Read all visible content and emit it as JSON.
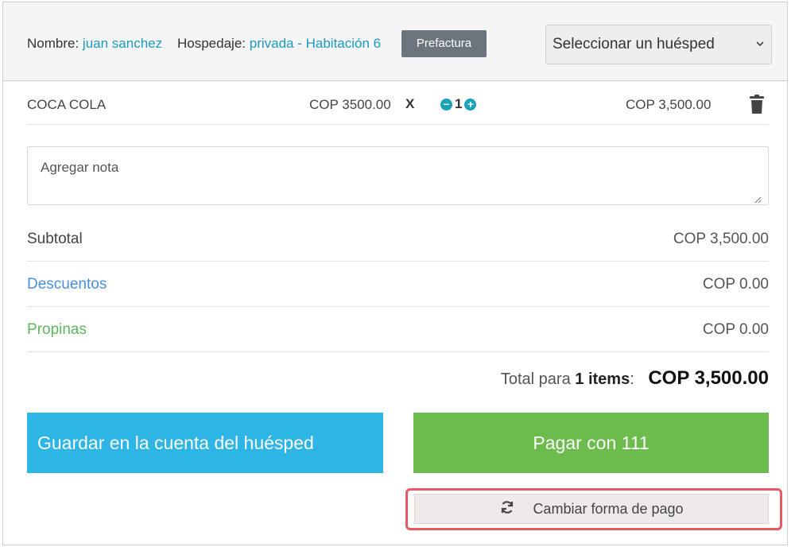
{
  "header": {
    "name_label": "Nombre:",
    "name_value": "juan sanchez",
    "lodging_label": "Hospedaje:",
    "lodging_value": "privada - Habitación 6",
    "prefactura_label": "Prefactura",
    "guest_select_value": "Seleccionar un huésped"
  },
  "items": [
    {
      "name": "COCA COLA",
      "unit_price": "COP 3500.00",
      "times": "X",
      "quantity": "1",
      "total": "COP 3,500.00"
    }
  ],
  "note": {
    "placeholder": "Agregar nota"
  },
  "summary": {
    "subtotal_label": "Subtotal",
    "subtotal_value": "COP 3,500.00",
    "discounts_label": "Descuentos",
    "discounts_value": "COP 0.00",
    "tips_label": "Propinas",
    "tips_value": "COP 0.00",
    "total_prefix": "Total para",
    "total_items": "1 items",
    "total_colon": ":",
    "total_value": "COP 3,500.00"
  },
  "actions": {
    "save_label": "Guardar en la cuenta del huésped",
    "pay_label": "Pagar con 111",
    "change_payment_label": "Cambiar forma de pago"
  },
  "colors": {
    "link": "#1a9ac0",
    "discounts": "#4a90e2",
    "tips": "#5cb85c",
    "save_button": "#2db5e6",
    "pay_button": "#6cbc4d",
    "highlight": "#ea5863"
  },
  "icons": {
    "trash": "trash-icon",
    "minus": "minus-circle-icon",
    "plus": "plus-circle-icon",
    "refresh": "refresh-icon",
    "chevron": "chevron-down-icon",
    "resize": "resize-grip-icon"
  }
}
